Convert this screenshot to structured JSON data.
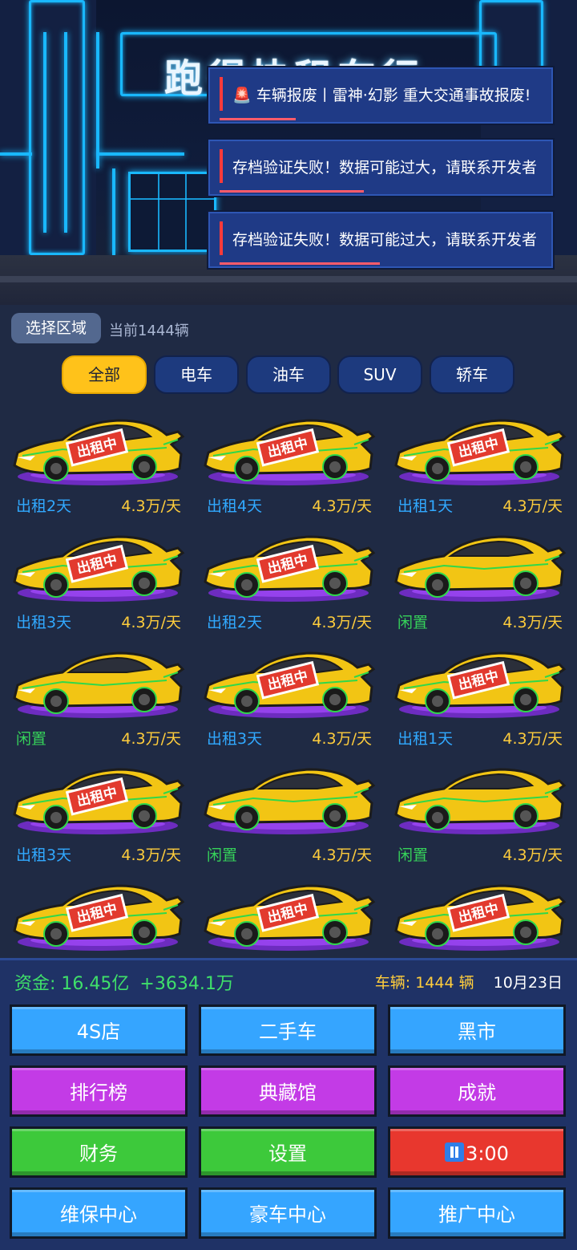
{
  "header": {
    "sign_text": "跑得快租车行"
  },
  "toasts": [
    {
      "icon": "🚨",
      "text": "车辆报废丨雷神·幻影 重大交通事故报废!"
    },
    {
      "text": "存档验证失败！数据可能过大，请联系开发者"
    },
    {
      "text": "存档验证失败！数据可能过大，请联系开发者"
    }
  ],
  "filter": {
    "region_button": "选择区域",
    "count_text": "当前1444辆",
    "tabs": [
      "全部",
      "电车",
      "油车",
      "SUV",
      "轿车"
    ],
    "active_tab": "全部"
  },
  "cars": [
    {
      "status": "出租2天",
      "price": "4.3万/天",
      "rented": true,
      "badge": "出租中"
    },
    {
      "status": "出租4天",
      "price": "4.3万/天",
      "rented": true,
      "badge": "出租中"
    },
    {
      "status": "出租1天",
      "price": "4.3万/天",
      "rented": true,
      "badge": "出租中"
    },
    {
      "status": "出租3天",
      "price": "4.3万/天",
      "rented": true,
      "badge": "出租中"
    },
    {
      "status": "出租2天",
      "price": "4.3万/天",
      "rented": true,
      "badge": "出租中"
    },
    {
      "status": "闲置",
      "price": "4.3万/天",
      "rented": false,
      "badge": ""
    },
    {
      "status": "闲置",
      "price": "4.3万/天",
      "rented": false,
      "badge": ""
    },
    {
      "status": "出租3天",
      "price": "4.3万/天",
      "rented": true,
      "badge": "出租中"
    },
    {
      "status": "出租1天",
      "price": "4.3万/天",
      "rented": true,
      "badge": "出租中"
    },
    {
      "status": "出租3天",
      "price": "4.3万/天",
      "rented": true,
      "badge": "出租中"
    },
    {
      "status": "闲置",
      "price": "4.3万/天",
      "rented": false,
      "badge": ""
    },
    {
      "status": "闲置",
      "price": "4.3万/天",
      "rented": false,
      "badge": ""
    },
    {
      "status": "",
      "price": "",
      "rented": true,
      "badge": "出租中"
    },
    {
      "status": "",
      "price": "",
      "rented": true,
      "badge": "出租中"
    },
    {
      "status": "",
      "price": "",
      "rented": true,
      "badge": "出租中"
    }
  ],
  "stats": {
    "funds_label": "资金:",
    "funds_value": "16.45亿",
    "income": "+3634.1万",
    "vehicles_label": "车辆:",
    "vehicles_value": "1444 辆",
    "date": "10月23日"
  },
  "buttons": {
    "shop_4s": "4S店",
    "used_car": "二手车",
    "black_market": "黑市",
    "ranking": "排行榜",
    "collection": "典藏馆",
    "achievement": "成就",
    "finance": "财务",
    "settings": "设置",
    "timer": "3:00",
    "maintenance": "维保中心",
    "luxury": "豪车中心",
    "promotion": "推广中心"
  },
  "colors": {
    "accent_yellow": "#ffc21a",
    "rent_blue": "#31a9ff",
    "idle_green": "#36d25a",
    "price_yellow": "#ffcd3c"
  }
}
